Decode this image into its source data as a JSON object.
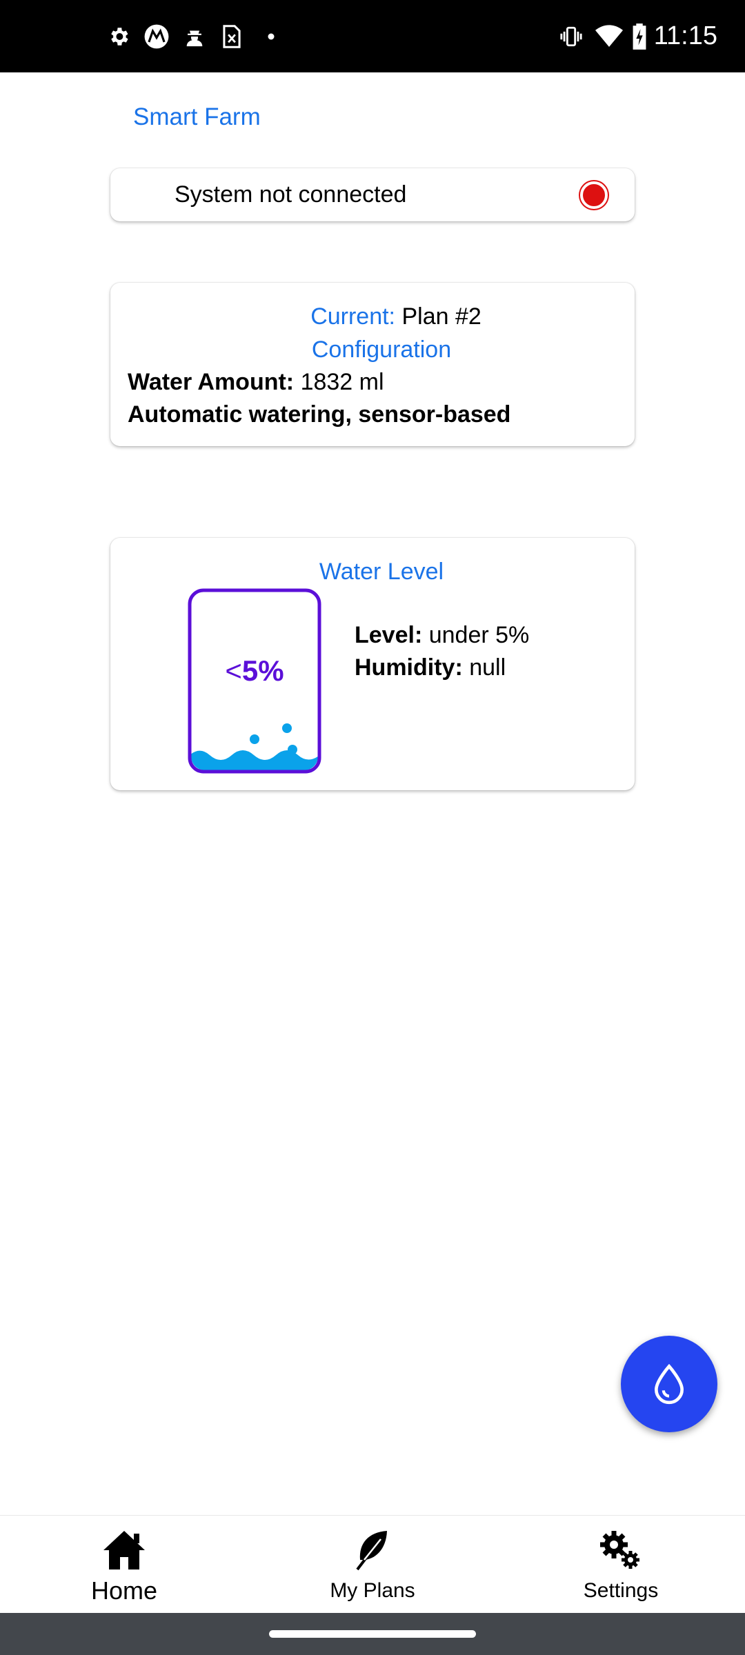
{
  "status_bar": {
    "time": "11:15",
    "left_icons": [
      "gear-icon",
      "motorola-icon",
      "spy-icon",
      "sim-card-icon",
      "dot-icon"
    ],
    "right_icons": [
      "vibrate-icon",
      "wifi-icon",
      "battery-icon"
    ]
  },
  "app": {
    "title": "Smart Farm"
  },
  "connection": {
    "text": "System not connected",
    "status_color": "#dd1111"
  },
  "plan": {
    "current_label": "Current:",
    "current_value": "Plan #2",
    "config_label": "Configuration",
    "water_amount_label": "Water Amount:",
    "water_amount_value": "1832 ml",
    "mode": "Automatic watering, sensor-based"
  },
  "water": {
    "title": "Water Level",
    "tank_prefix": "<",
    "tank_value": "5%",
    "level_label": "Level:",
    "level_value": "under 5%",
    "humidity_label": "Humidity:",
    "humidity_value": "null",
    "tank_color": "#5b0fd8",
    "water_color": "#0aa2ea"
  },
  "fab": {
    "icon": "water-drop-icon",
    "color": "#2545f0"
  },
  "nav": {
    "items": [
      {
        "label": "Home",
        "icon": "home-icon",
        "active": true
      },
      {
        "label": "My Plans",
        "icon": "leaf-icon",
        "active": false
      },
      {
        "label": "Settings",
        "icon": "gears-icon",
        "active": false
      }
    ]
  },
  "colors": {
    "accent": "#1a73e8",
    "status_bar": "#000000",
    "gesture_bar": "#43474c"
  }
}
